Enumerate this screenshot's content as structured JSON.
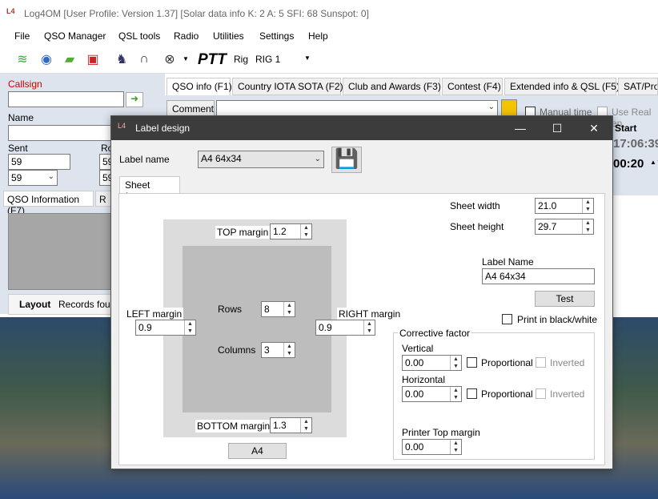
{
  "window": {
    "title": "Log4OM [User Profile: Version 1.37] [Solar data info K: 2 A: 5 SFI: 68 Sunspot: 0]"
  },
  "menu": [
    "File",
    "QSO Manager",
    "QSL tools",
    "Radio",
    "Utilities",
    "Settings",
    "Help"
  ],
  "toolbar": {
    "ptt": "PTT",
    "rig_label": "Rig",
    "rig_value": "RIG 1"
  },
  "left": {
    "callsign_label": "Callsign",
    "name_label": "Name",
    "sent_label": "Sent",
    "sent_value": "59",
    "sent_combo": "59",
    "rcvd_label": "Ro",
    "rcvd_value": "59",
    "rcvd_combo": "59",
    "info_tab": "QSO Information (F7)",
    "info_tab2": "R",
    "layout_label": "Layout",
    "records_label": "Records four"
  },
  "tabs": [
    "QSO info (F1)",
    "Country IOTA SOTA (F2)",
    "Club and Awards (F3)",
    "Contest (F4)",
    "Extended info & QSL (F5)",
    "SAT/Pro"
  ],
  "qso": {
    "comment_label": "Comment",
    "manual_time": "Manual time",
    "use_real": "Use Real en",
    "start_label": "Start",
    "time1": "17:06:39",
    "time2": "00:20"
  },
  "dialog": {
    "title": "Label design",
    "label_name_label": "Label name",
    "label_name_value": "A4 64x34",
    "tab_label": "Sheet format",
    "top_margin_label": "TOP margin",
    "top_margin": "1.2",
    "left_margin_label": "LEFT margin",
    "left_margin": "0.9",
    "right_margin_label": "RIGHT margin",
    "right_margin": "0.9",
    "bottom_margin_label": "BOTTOM margin",
    "bottom_margin": "1.3",
    "rows_label": "Rows",
    "rows": "8",
    "columns_label": "Columns",
    "columns": "3",
    "a4_button": "A4",
    "sheet_width_label": "Sheet width",
    "sheet_width": "21.0",
    "sheet_height_label": "Sheet height",
    "sheet_height": "29.7",
    "label_name2_label": "Label Name",
    "label_name2_value": "A4 64x34",
    "test_button": "Test",
    "print_bw": "Print in black/white",
    "corrective_label": "Corrective factor",
    "vertical_label": "Vertical",
    "vertical": "0.00",
    "horizontal_label": "Horizontal",
    "horizontal": "0.00",
    "proportional": "Proportional",
    "inverted": "Inverted",
    "printer_top_label": "Printer Top margin",
    "printer_top": "0.00"
  }
}
